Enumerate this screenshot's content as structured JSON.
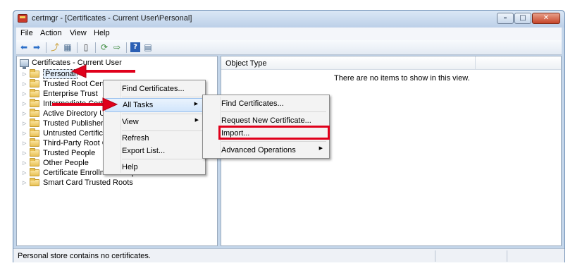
{
  "window": {
    "title": "certmgr - [Certificates - Current User\\Personal]"
  },
  "menubar": {
    "items": [
      "File",
      "Action",
      "View",
      "Help"
    ]
  },
  "toolbar": {
    "icons": [
      "back-arrow-icon",
      "forward-arrow-icon",
      "up-folder-icon",
      "show-hide-tree-icon",
      "properties-icon",
      "refresh-icon",
      "export-list-icon",
      "help-icon",
      "mmc-icon"
    ]
  },
  "tree": {
    "root_label": "Certificates - Current User",
    "items": [
      {
        "label": "Personal",
        "selected": true
      },
      {
        "label": "Trusted Root Certification Authorities"
      },
      {
        "label": "Enterprise Trust"
      },
      {
        "label": "Intermediate Certification Authorities"
      },
      {
        "label": "Active Directory User Object"
      },
      {
        "label": "Trusted Publishers"
      },
      {
        "label": "Untrusted Certificates"
      },
      {
        "label": "Third-Party Root Certification Authorities"
      },
      {
        "label": "Trusted People"
      },
      {
        "label": "Other People"
      },
      {
        "label": "Certificate Enrollment Requests"
      },
      {
        "label": "Smart Card Trusted Roots"
      }
    ]
  },
  "right_pane": {
    "column_header": "Object Type",
    "empty_message": "There are no items to show in this view."
  },
  "context_menu": {
    "items": [
      {
        "label": "Find Certificates...",
        "submenu": false
      },
      {
        "label": "All Tasks",
        "submenu": true,
        "highlighted": true
      },
      {
        "label": "View",
        "submenu": true
      },
      {
        "label": "Refresh",
        "submenu": false
      },
      {
        "label": "Export List...",
        "submenu": false
      },
      {
        "label": "Help",
        "submenu": false
      }
    ]
  },
  "submenu": {
    "items": [
      {
        "label": "Find Certificates..."
      },
      {
        "label": "Request New Certificate..."
      },
      {
        "label": "Import...",
        "annotated": true
      },
      {
        "label": "Advanced Operations",
        "submenu": true
      }
    ]
  },
  "statusbar": {
    "text": "Personal store contains no certificates."
  },
  "annotation_color": "#e0001b"
}
